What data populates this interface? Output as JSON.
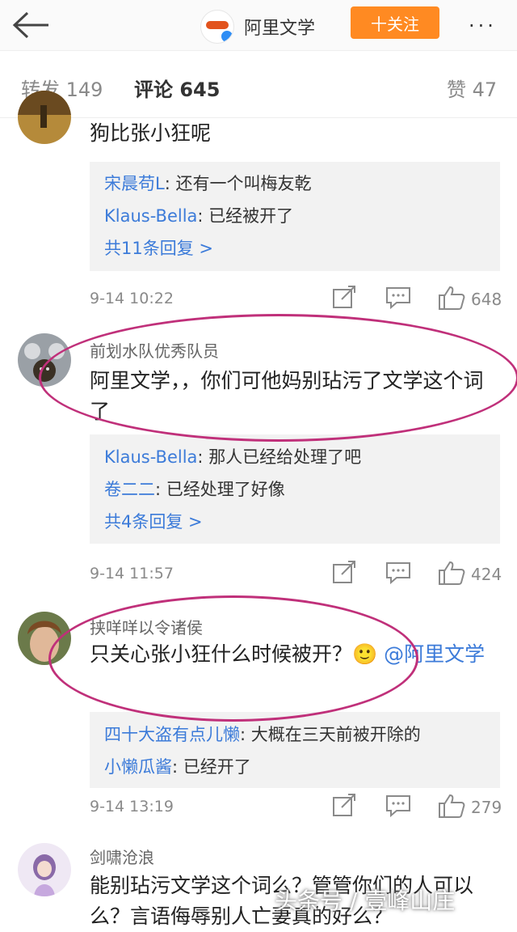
{
  "header": {
    "account_name": "阿里文学",
    "follow_label": "十关注",
    "more_label": "···"
  },
  "tabs": {
    "reposts": "转发 149",
    "comments": "评论 645",
    "likes": "赞 47"
  },
  "comments": [
    {
      "author": "",
      "text": "狗比张小狂呢",
      "replies": [
        {
          "name": "宋晨苟L",
          "sep": ": ",
          "text": "还有一个叫梅友乾"
        },
        {
          "name": "Klaus-Bella",
          "sep": ": ",
          "text": "已经被开了"
        }
      ],
      "more_replies": "共11条回复 >",
      "time": "9-14 10:22",
      "likes": "648"
    },
    {
      "author": "前划水队优秀队员",
      "text": "阿里文学，，你们可他妈别玷污了文学这个词了",
      "replies": [
        {
          "name": "Klaus-Bella",
          "sep": ": ",
          "text": "那人已经给处理了吧"
        },
        {
          "name": "卷二二",
          "sep": ": ",
          "text": "已经处理了好像"
        }
      ],
      "more_replies": "共4条回复 >",
      "time": "9-14 11:57",
      "likes": "424"
    },
    {
      "author": "挟咩咩以令诸侯",
      "text": "只关心张小狂什么时候被开？🙂 ",
      "mention": "@阿里文学",
      "replies": [
        {
          "name": "四十大盗有点儿懒",
          "sep": ": ",
          "text": "大概在三天前被开除的"
        },
        {
          "name": "小懒瓜酱",
          "sep": ": ",
          "text": "已经开了"
        }
      ],
      "time": "9-14 13:19",
      "likes": "279"
    },
    {
      "author": "剑啸沧浪",
      "text": "能别玷污文学这个词么？管管你们的人可以么？言语侮辱别人亡妻真的好么？"
    }
  ],
  "watermark": "头条号 / 壹峰山庄",
  "colors": {
    "accent": "#ff8a22",
    "link": "#3c7bd9",
    "highlight_circle": "#c0307a"
  },
  "icons": [
    "back-arrow-icon",
    "verified-icon",
    "share-icon",
    "comment-icon",
    "thumbs-up-icon"
  ]
}
